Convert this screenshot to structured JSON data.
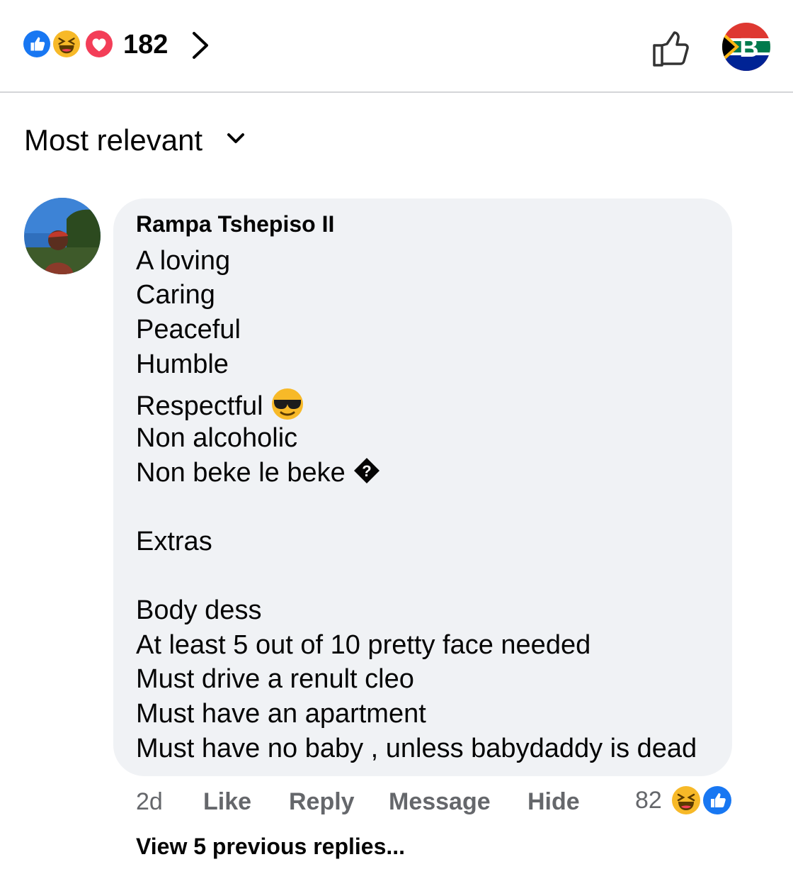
{
  "header": {
    "reaction_icons": [
      "like-reaction-icon",
      "haha-reaction-icon",
      "love-reaction-icon"
    ],
    "reaction_count": "182",
    "colors": {
      "like_blue": "#1877f2",
      "love_red": "#f33e58",
      "haha_yellow": "#f7b928"
    }
  },
  "sort": {
    "label": "Most relevant"
  },
  "comment": {
    "author": "Rampa Tshepiso II",
    "lines": [
      "A loving",
      "Caring",
      "Peaceful",
      "Humble",
      "Respectful",
      "Non alcoholic",
      "Non beke le beke",
      "",
      "Extras",
      "",
      "Body dess",
      "At least 5 out of 10 pretty face needed",
      "Must drive a renult cleo",
      "Must have an apartment",
      "Must have no baby , unless babydaddy is dead"
    ],
    "time": "2d",
    "actions": {
      "like": "Like",
      "reply": "Reply",
      "message": "Message",
      "hide": "Hide"
    },
    "reaction_count": "82",
    "reaction_icons": [
      "haha-reaction-icon",
      "like-reaction-icon"
    ]
  },
  "replies": {
    "label": "View 5 previous replies..."
  }
}
